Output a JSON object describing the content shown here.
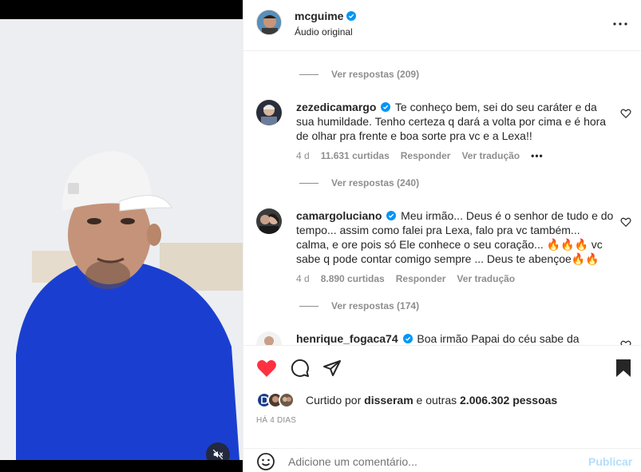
{
  "post": {
    "username": "mcguime",
    "audio": "Áudio original"
  },
  "comments": [
    {
      "username": "zezedicamargo",
      "text": "Te conheço bem, sei do seu caráter e da sua humildade. Tenho certeza q dará a volta por cima e é hora de olhar pra frente e boa sorte pra vc e a Lexa!!",
      "age": "4 d",
      "likes": "11.631 curtidas",
      "reply": "Responder",
      "translate": "Ver tradução",
      "more": "•••"
    },
    {
      "username": "camargoluciano",
      "text": "Meu irmão... Deus é o senhor de tudo e do tempo... assim como falei pra Lexa, falo pra vc também... calma, e ore pois só Ele conhece o seu coração... 🔥🔥🔥 vc sabe q pode contar comigo sempre ... Deus te abençoe🔥🔥",
      "age": "4 d",
      "likes": "8.890 curtidas",
      "reply": "Responder",
      "translate": "Ver tradução"
    },
    {
      "username": "henrique_fogaca74",
      "text": "Boa irmão Papai do céu sabe da"
    }
  ],
  "replies": [
    "Ver respostas (209)",
    "Ver respostas (240)",
    "Ver respostas (174)"
  ],
  "footer": {
    "liked_prefix": "Curtido por",
    "liked_user": "disseram",
    "liked_middle": "e outras",
    "liked_count": "2.006.302 pessoas",
    "timestamp": "HÁ 4 DIAS",
    "comment_placeholder": "Adicione um comentário...",
    "publish": "Publicar"
  },
  "colors": {
    "like_red": "#ff3040",
    "verified_blue": "#0095f6",
    "publish_disabled": "#b2dffc",
    "video_shirt": "#1a3fd0"
  }
}
